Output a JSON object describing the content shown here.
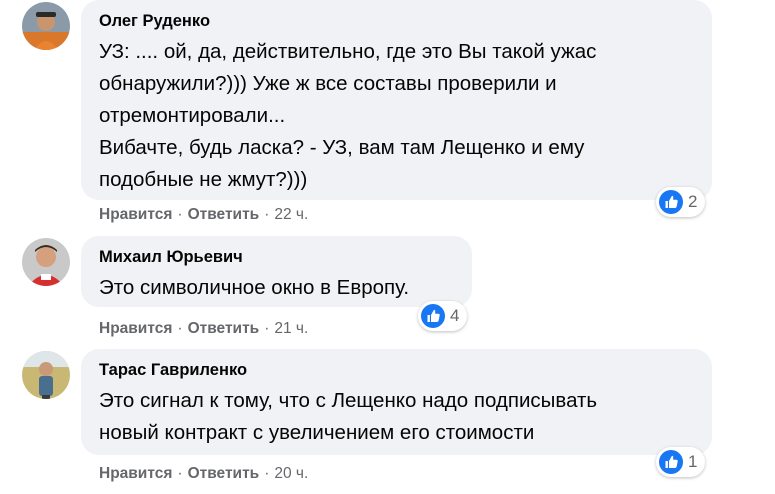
{
  "colors": {
    "bubble": "#f0f2f5",
    "like": "#1877f2",
    "meta_text": "#65676b"
  },
  "comments": [
    {
      "author": "Олег Руденко",
      "lines": [
        "УЗ: .... ой, да, действительно, где это Вы такой ужас",
        "обнаружили?))) Уже ж все составы проверили и",
        "отремонтировали...",
        "Вибачте, будь ласка? - УЗ, вам там Лещенко и ему",
        "подобные не жмут?)))"
      ],
      "reaction_count": "2",
      "like_label": "Нравится",
      "reply_label": "Ответить",
      "time": "22 ч.",
      "reaction_icon": "like-icon"
    },
    {
      "author": "Михаил Юрьевич",
      "lines": [
        "Это символичное окно в Европу."
      ],
      "reaction_count": "4",
      "like_label": "Нравится",
      "reply_label": "Ответить",
      "time": "21 ч.",
      "reaction_icon": "like-icon"
    },
    {
      "author": "Тарас Гавриленко",
      "lines": [
        "Это сигнал к тому, что с Лещенко надо подписывать",
        "новый контракт с увеличением его стоимости"
      ],
      "reaction_count": "1",
      "like_label": "Нравится",
      "reply_label": "Ответить",
      "time": "20 ч.",
      "reaction_icon": "like-icon"
    }
  ]
}
